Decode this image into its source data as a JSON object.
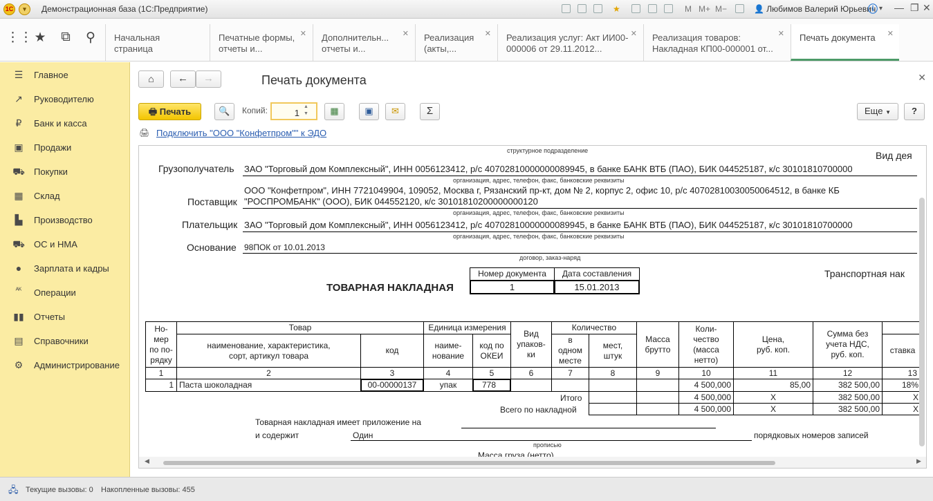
{
  "window": {
    "app_title": "Демонстрационная база  (1С:Предприятие)",
    "user_name": "Любимов Валерий Юрьевич",
    "m_buttons": [
      "M",
      "M+",
      "M−"
    ]
  },
  "tabs": [
    {
      "label": "Начальная страница"
    },
    {
      "label": "Печатные формы, отчеты и..."
    },
    {
      "label": "Дополнительн... отчеты и..."
    },
    {
      "label": "Реализация (акты,..."
    },
    {
      "label": "Реализация услуг: Акт ИИ00-000006 от 29.11.2012..."
    },
    {
      "label": "Реализация товаров: Накладная КП00-000001 от..."
    },
    {
      "label": "Печать документа"
    }
  ],
  "sidebar": {
    "items": [
      {
        "label": "Главное",
        "icon": "menu-icon"
      },
      {
        "label": "Руководителю",
        "icon": "trend-icon"
      },
      {
        "label": "Банк и касса",
        "icon": "ruble-icon"
      },
      {
        "label": "Продажи",
        "icon": "bag-icon"
      },
      {
        "label": "Покупки",
        "icon": "cart-icon"
      },
      {
        "label": "Склад",
        "icon": "warehouse-icon"
      },
      {
        "label": "Производство",
        "icon": "factory-icon"
      },
      {
        "label": "ОС и НМА",
        "icon": "truck-icon"
      },
      {
        "label": "Зарплата и кадры",
        "icon": "people-icon"
      },
      {
        "label": "Операции",
        "icon": "operations-icon"
      },
      {
        "label": "Отчеты",
        "icon": "bar-chart-icon"
      },
      {
        "label": "Справочники",
        "icon": "book-icon"
      },
      {
        "label": "Администрирование",
        "icon": "gear-icon"
      }
    ]
  },
  "toolbar": {
    "page_title": "Печать документа",
    "print_label": "Печать",
    "copies_label": "Копий:",
    "copies_value": "1",
    "more_label": "Еще",
    "help_label": "?",
    "sum_label": "Σ",
    "edo_link": "Подключить \"ООО \"Конфетпром\"\" к ЭДО"
  },
  "doc": {
    "struct_div": "структурное подразделение",
    "activity": "Вид дея",
    "consignee_label": "Грузополучатель",
    "consignee_value": "ЗАО \"Торговый дом Комплексный\", ИНН 0056123412, р/с 40702810000000089945, в банке БАНК ВТБ (ПАО), БИК 044525187, к/с 30101810700000",
    "org_hint": "организация, адрес, телефон, факс, банковские реквизиты",
    "supplier_label": "Поставщик",
    "supplier_value_1": "ООО \"Конфетпром\", ИНН 7721049904, 109052, Москва г, Рязанский пр-кт, дом № 2, корпус 2, офис 10, р/с 40702810030050064512, в банке КБ",
    "supplier_value_2": "\"РОСПРОМБАНК\" (ООО), БИК 044552120, к/с 30101810200000000120",
    "payer_label": "Плательщик",
    "payer_value": "ЗАО \"Торговый дом Комплексный\", ИНН 0056123412, р/с 40702810000000089945, в банке БАНК ВТБ (ПАО), БИК 044525187, к/с 30101810700000",
    "basis_label": "Основание",
    "basis_value": "98ПОК от 10.01.2013",
    "contract_hint": "договор, заказ-наряд",
    "doc_num_header": "Номер документа",
    "doc_date_header": "Дата составления",
    "doc_num": "1",
    "doc_date": "15.01.2013",
    "form_title": "ТОВАРНАЯ НАКЛАДНАЯ",
    "transport": "Транспортная нак",
    "table": {
      "h_num": "Но-\nмер\nпо по-\nрядку",
      "h_goods": "Товар",
      "h_goods_name": "наименование, характеристика, сорт, артикул товара",
      "h_code": "код",
      "h_unit": "Единица измерения",
      "h_unit_name": "наиме-\nнование",
      "h_okei": "код по\nОКЕИ",
      "h_pack": "Вид\nупаков-\nки",
      "h_qty": "Количество",
      "h_in_place": "в\nодном\nместе",
      "h_places": "мест,\nштук",
      "h_gross": "Масса\nбрутто",
      "h_net": "Коли-\nчество\n(масса\nнетто)",
      "h_price": "Цена,\nруб. коп.",
      "h_sum": "Сумма без\nучета НДС,\nруб. коп.",
      "h_rate": "ставка",
      "col_nums": [
        "1",
        "2",
        "3",
        "4",
        "5",
        "6",
        "7",
        "8",
        "9",
        "10",
        "11",
        "12",
        "13"
      ],
      "row": {
        "num": "1",
        "name": "Паста шоколадная",
        "code": "00-00000137",
        "unit": "упак",
        "okei": "778",
        "qty": "4 500,000",
        "price": "85,00",
        "sum": "382 500,00",
        "rate": "18%"
      },
      "total_label": "Итого",
      "total_qty": "4 500,000",
      "total_price": "X",
      "total_sum": "382 500,00",
      "total_rate": "X",
      "grand_label": "Всего по накладной",
      "grand_qty": "4 500,000",
      "grand_price": "X",
      "grand_sum": "382 500,00",
      "grand_rate": "X"
    },
    "appendix_1": "Товарная накладная имеет приложение на",
    "appendix_2": "и содержит",
    "appendix_value": "Один",
    "appendix_3": "порядковых номеров записей",
    "in_words_hint": "прописью",
    "cargo_mass": "Масса груза (нетто)"
  },
  "statusbar": {
    "current_calls": "Текущие вызовы: 0",
    "accumulated_calls": "Накопленные вызовы: 455"
  }
}
